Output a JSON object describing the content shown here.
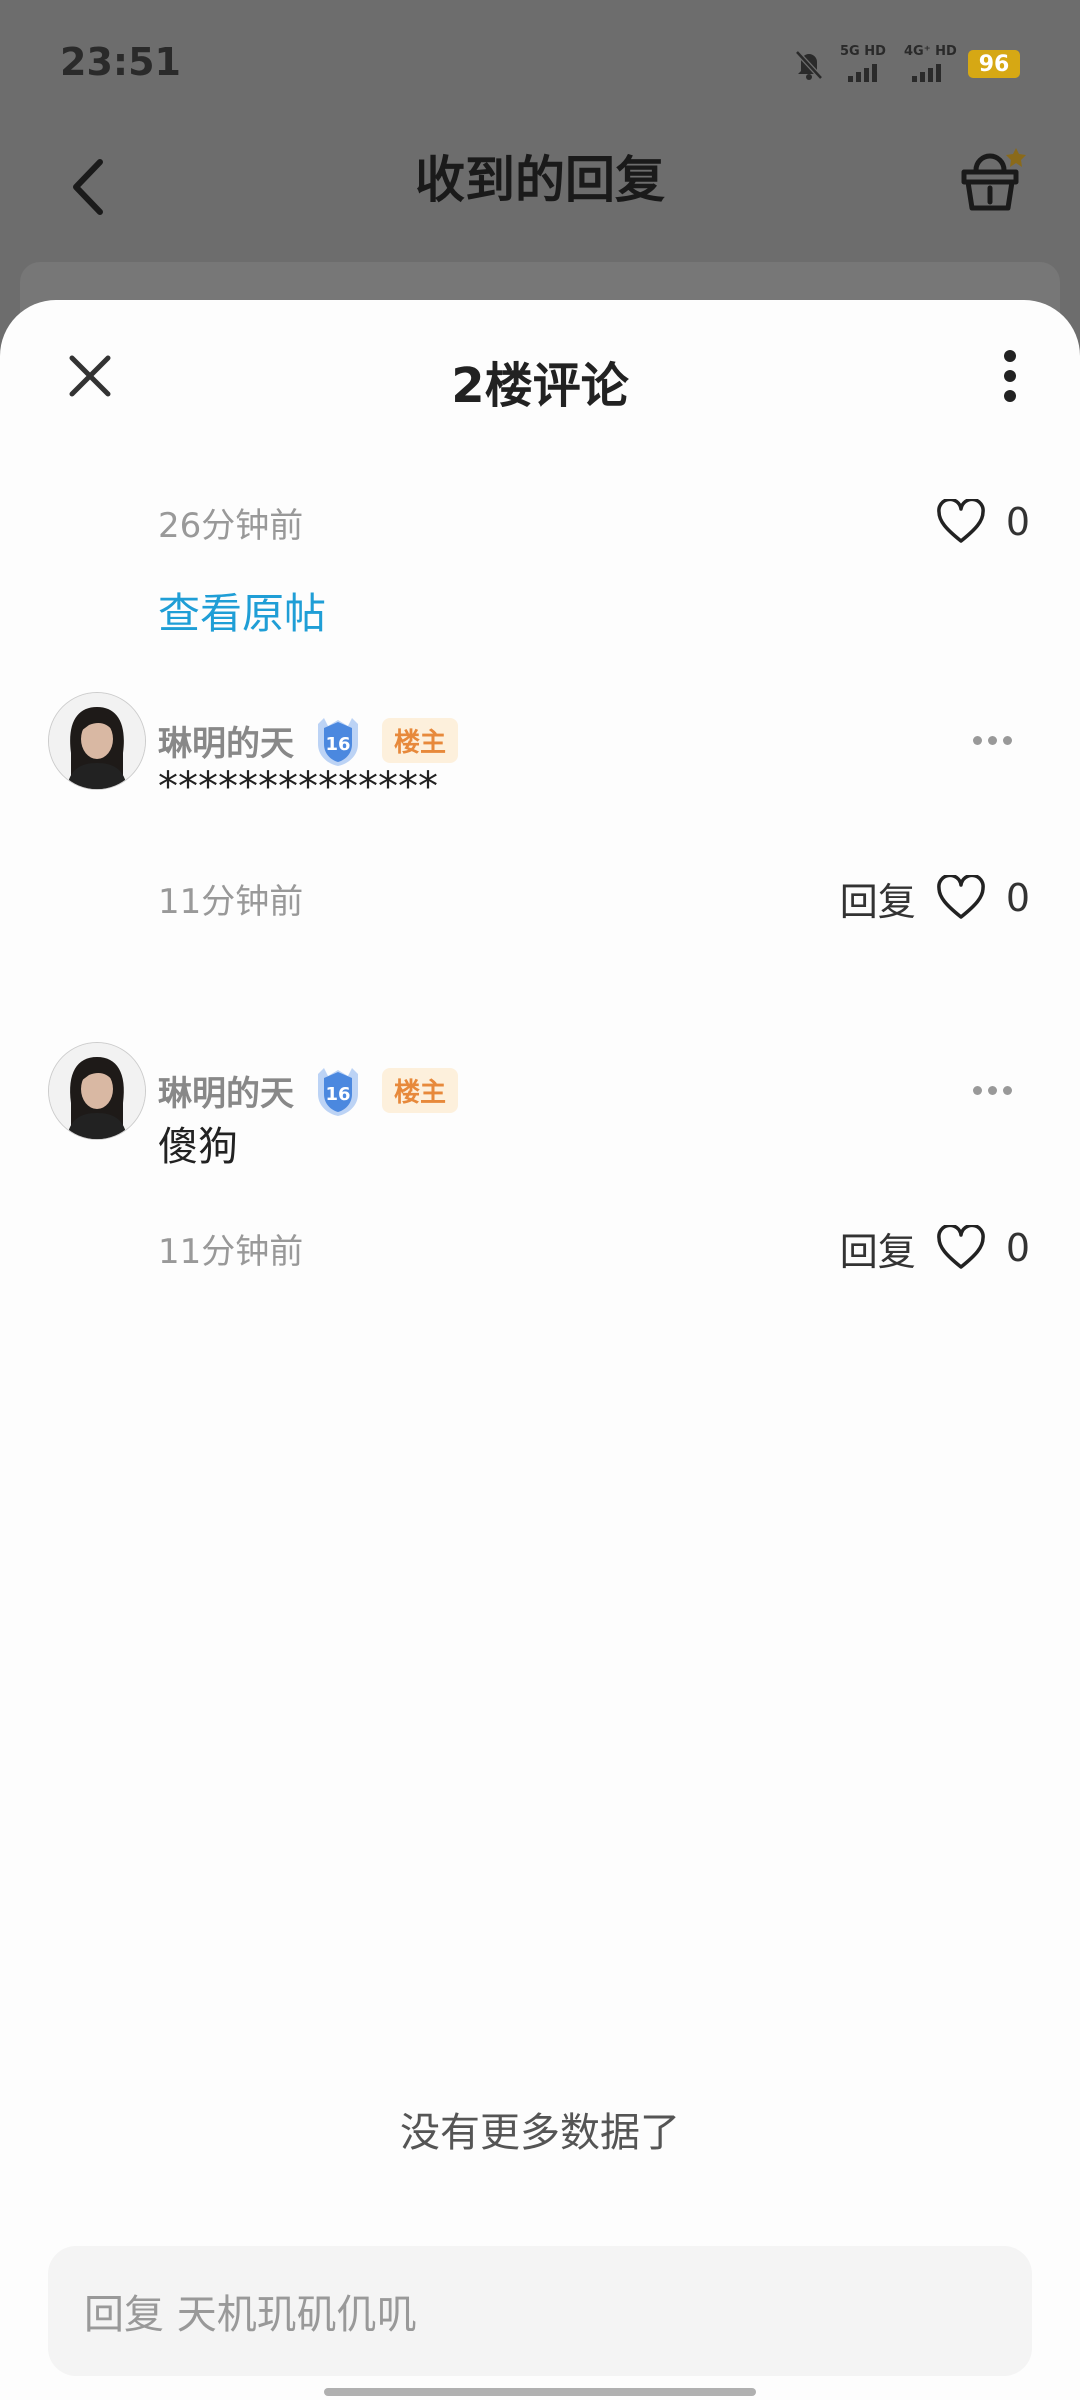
{
  "status_bar": {
    "time": "23:51",
    "net1_label": "5G HD",
    "net2_label": "4G⁺ HD",
    "battery": "96"
  },
  "background_page": {
    "title": "收到的回复"
  },
  "sheet": {
    "title": "2楼评论",
    "main_comment": {
      "time": "26分钟前",
      "like_count": "0",
      "view_original_post": "查看原帖"
    },
    "replies": [
      {
        "username": "琳明的天",
        "level": "16",
        "host_badge": "楼主",
        "text": "**************",
        "time": "11分钟前",
        "reply_label": "回复",
        "like_count": "0"
      },
      {
        "username": "琳明的天",
        "level": "16",
        "host_badge": "楼主",
        "text": "傻狗",
        "time": "11分钟前",
        "reply_label": "回复",
        "like_count": "0"
      }
    ],
    "no_more_data": "没有更多数据了",
    "reply_input_placeholder": "回复 天机玑矶仉叽"
  },
  "colors": {
    "accent_link": "#1f9ed6",
    "host_badge_text": "#e7893b",
    "host_badge_bg": "#fdf0dc",
    "battery": "#d6a814",
    "overlay": "#6d6d6d"
  },
  "icons": [
    "back-arrow-icon",
    "basket-icon",
    "close-icon",
    "more-vertical-icon",
    "heart-icon",
    "more-horizontal-icon",
    "level-shield-icon"
  ]
}
